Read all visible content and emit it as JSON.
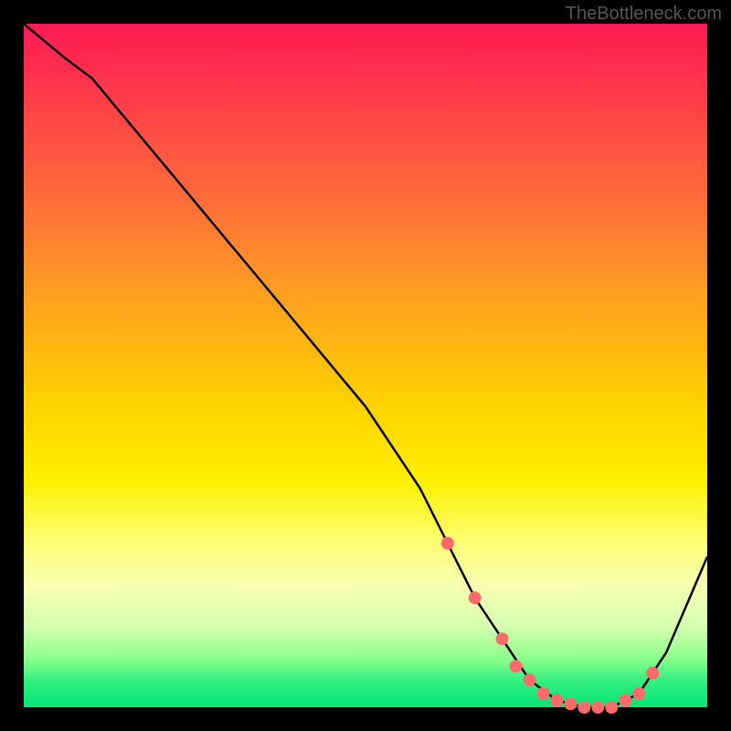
{
  "watermark": "TheBottleneck.com",
  "chart_data": {
    "type": "line",
    "title": "",
    "xlabel": "",
    "ylabel": "",
    "xlim": [
      0,
      100
    ],
    "ylim": [
      0,
      100
    ],
    "series": [
      {
        "name": "bottleneck-curve",
        "x": [
          0,
          6,
          10,
          20,
          30,
          40,
          50,
          58,
          62,
          66,
          70,
          74,
          78,
          82,
          86,
          90,
          94,
          100
        ],
        "values": [
          100,
          95,
          92,
          80,
          68,
          56,
          44,
          32,
          24,
          16,
          10,
          4,
          1,
          0,
          0,
          2,
          8,
          22
        ]
      }
    ],
    "markers": {
      "name": "highlight-points",
      "color": "#ff6b6b",
      "x": [
        62,
        66,
        70,
        72,
        74,
        76,
        78,
        80,
        82,
        84,
        86,
        88,
        90,
        92
      ],
      "values": [
        24,
        16,
        10,
        6,
        4,
        2,
        1,
        0.5,
        0,
        0,
        0,
        1,
        2,
        5
      ]
    }
  }
}
